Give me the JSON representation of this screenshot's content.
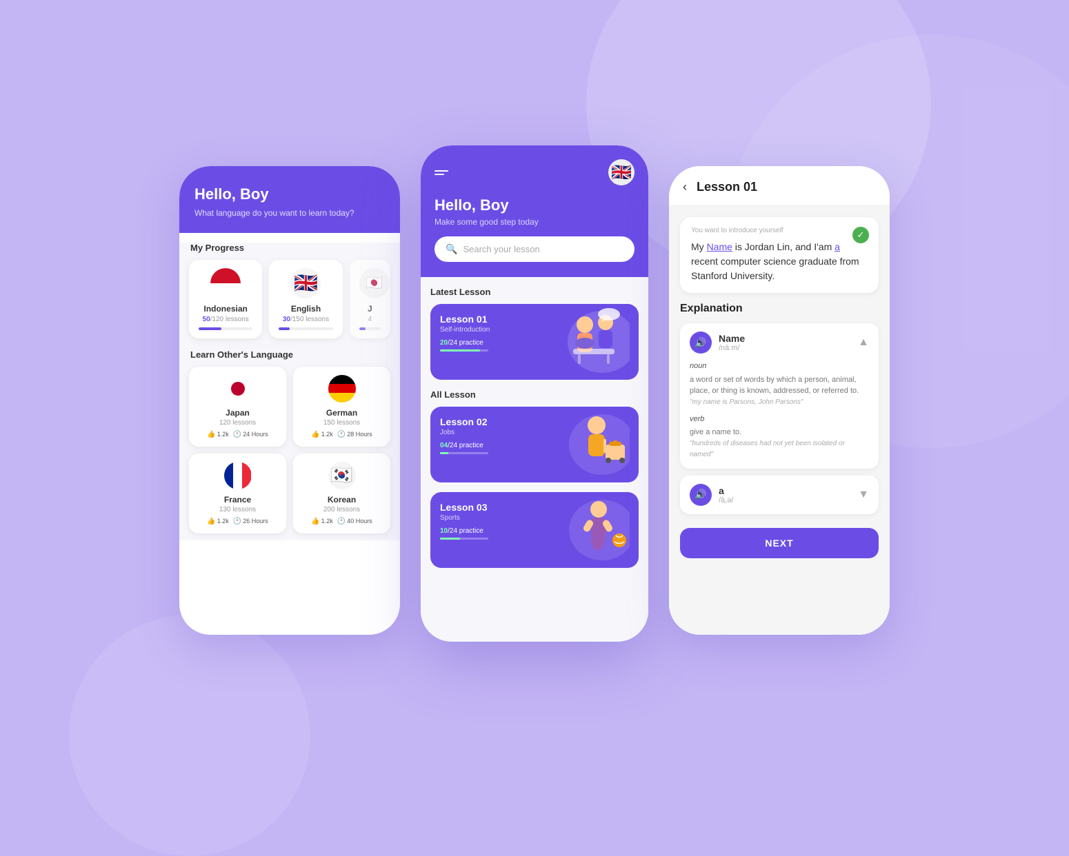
{
  "background": {
    "color": "#c4b5f5"
  },
  "phone1": {
    "header": {
      "greeting": "Hello, Boy",
      "subtitle": "What language do you want to learn today?"
    },
    "my_progress": {
      "section_title": "My Progress",
      "languages": [
        {
          "name": "Indonesian",
          "lessons_done": "50",
          "lessons_total": "120",
          "lessons_label": "50/120 lessons",
          "progress_pct": 42,
          "flag": "id"
        },
        {
          "name": "English",
          "lessons_done": "30",
          "lessons_total": "150",
          "lessons_label": "30/150 lessons",
          "progress_pct": 20,
          "flag": "uk"
        }
      ]
    },
    "learn_others": {
      "section_title": "Learn Other's Language",
      "languages": [
        {
          "name": "Japan",
          "lessons": "120 lessons",
          "likes": "1.2k",
          "hours": "24 Hours",
          "flag": "jp"
        },
        {
          "name": "German",
          "lessons": "150 lessons",
          "likes": "1.2k",
          "hours": "28 Hours",
          "flag": "de"
        },
        {
          "name": "France",
          "lessons": "130 lessons",
          "likes": "1.2k",
          "hours": "26 Hours",
          "flag": "fr"
        },
        {
          "name": "Korean",
          "lessons": "200 lessons",
          "likes": "1.2k",
          "hours": "40 Hours",
          "flag": "kr"
        }
      ]
    }
  },
  "phone2": {
    "nav": {
      "menu_icon": "menu-icon",
      "flag": "uk"
    },
    "header": {
      "greeting": "Hello, Boy",
      "subtitle": "Make some good step today"
    },
    "search": {
      "placeholder": "Search your lesson"
    },
    "latest_lesson": {
      "section_title": "Latest Lesson",
      "card": {
        "title": "Lesson 01",
        "subtitle": "Self-introduction",
        "practice_done": "20",
        "practice_total": "24",
        "practice_label": "20/24 practice",
        "progress_pct": 83
      }
    },
    "all_lesson": {
      "section_title": "All Lesson",
      "cards": [
        {
          "title": "Lesson 02",
          "subtitle": "Jobs",
          "practice_done": "04",
          "practice_total": "24",
          "practice_label": "04/24 practice",
          "progress_pct": 17
        },
        {
          "title": "Lesson 03",
          "subtitle": "Sports",
          "practice_done": "10",
          "practice_total": "24",
          "practice_label": "10/24 practice",
          "progress_pct": 42
        }
      ]
    }
  },
  "phone3": {
    "header": {
      "back_label": "‹",
      "title": "Lesson 01"
    },
    "sentence_card": {
      "label": "You want to introduce yourself",
      "text_part1": "My ",
      "underlined_word": "Name",
      "text_part2": " is Jordan Lin, and I'am ",
      "underlined_a": "a",
      "text_part3": " recent computer science graduate from Stanford University."
    },
    "explanation": {
      "title": "Explanation",
      "words": [
        {
          "word": "Name",
          "phonetic": "/nāːm/",
          "expanded": true,
          "pos1": "noun",
          "def1": "a word or set of words by which a person, animal, place, or thing is known, addressed, or referred to.",
          "example1": "\"my name is Parsons, John Parsons\"",
          "pos2": "verb",
          "def2": "give a name to.",
          "example2": "\"hundreds of diseases had not yet been isolated or named\""
        },
        {
          "word": "a",
          "phonetic": "/ā,ə/",
          "expanded": false
        }
      ]
    },
    "next_button": "NEXT"
  }
}
